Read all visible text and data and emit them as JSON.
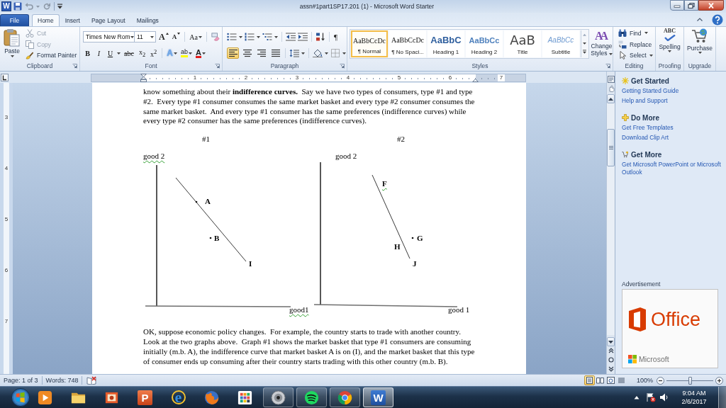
{
  "title_bar": {
    "app_glyph": "W",
    "title": "assn#1part1SP17.201 (1) - Microsoft Word Starter"
  },
  "tabs": [
    {
      "label": "File",
      "kind": "file",
      "selected": false
    },
    {
      "label": "Home",
      "kind": "tab",
      "selected": true
    },
    {
      "label": "Insert",
      "kind": "tab",
      "selected": false
    },
    {
      "label": "Page Layout",
      "kind": "tab",
      "selected": false
    },
    {
      "label": "Mailings",
      "kind": "tab",
      "selected": false
    }
  ],
  "clipboard": {
    "paste": "Paste",
    "actions": [
      {
        "label": "Cut",
        "kind": "cut",
        "disabled": true
      },
      {
        "label": "Copy",
        "kind": "copy",
        "disabled": true
      },
      {
        "label": "Format Painter",
        "kind": "painter",
        "disabled": false
      }
    ],
    "label": "Clipboard"
  },
  "font": {
    "name": "Times New Rom",
    "size": "11",
    "grow": "A",
    "shrink": "A",
    "change_case": "Aa",
    "formats": [
      {
        "label": "B",
        "kind": "bold"
      },
      {
        "label": "I",
        "kind": "italic"
      },
      {
        "label": "U",
        "kind": "underline"
      },
      {
        "label": "abc",
        "kind": "strike"
      },
      {
        "label": "x$_{2}$",
        "kind": "subscript"
      },
      {
        "label": "x$^{2}$",
        "kind": "superscript"
      }
    ],
    "effects": "A",
    "highlight": "ab",
    "color_button": "A",
    "label": "Font"
  },
  "paragraph": {
    "show_marks": "¶",
    "alignments": [
      {
        "kind": "left",
        "selected": true
      },
      {
        "kind": "center",
        "selected": false
      },
      {
        "kind": "right",
        "selected": false
      },
      {
        "kind": "justify",
        "selected": false
      }
    ],
    "label": "Paragraph"
  },
  "styles": {
    "gallery": [
      {
        "sample": "AaBbCcDc",
        "name": "¶ Normal",
        "kind": "normal",
        "selected": true
      },
      {
        "sample": "AaBbCcDc",
        "name": "¶ No Spaci...",
        "kind": "normal",
        "selected": false
      },
      {
        "sample": "AaBbC",
        "name": "Heading 1",
        "kind": "heading1",
        "selected": false
      },
      {
        "sample": "AaBbCc",
        "name": "Heading 2",
        "kind": "heading2",
        "selected": false
      },
      {
        "sample": "AaB",
        "name": "Title",
        "kind": "title",
        "selected": false
      },
      {
        "sample": "AaBbCc",
        "name": "Subtitle",
        "kind": "subtitle",
        "selected": false
      }
    ],
    "change_glyph": "AA",
    "change": "Change Styles",
    "label": "Styles"
  },
  "editing": {
    "actions": [
      {
        "label": "Find",
        "kind": "find",
        "menu": true
      },
      {
        "label": "Replace",
        "kind": "replace",
        "menu": false
      },
      {
        "label": "Select",
        "kind": "select",
        "menu": true
      }
    ],
    "label": "Editing"
  },
  "proofing": {
    "glyph": "ABC",
    "button": "Spelling",
    "label": "Proofing"
  },
  "upgrade": {
    "button": "Purchase",
    "label": "Upgrade"
  },
  "rulers": {
    "horizontal": [
      "1",
      "2",
      "3",
      "4",
      "5",
      "6",
      "7"
    ],
    "vertical": [
      "3",
      "4",
      "5",
      "6",
      "7"
    ]
  },
  "document": {
    "intro": "know something about their **indifference curves.**  Say we have two types of consumers, type #1 and type #2.  Every type #1 consumer consumes the same market basket and every type #2 consumer consumes the same market basket.  And every type #1 consumer has the same preferences (indifference curves) while every type #2 consumer has the same preferences (indifference curves).",
    "graphs": [
      {
        "heading": "#1",
        "y_label": {
          "text": "good 2",
          "flagged": true
        },
        "x_label": {
          "text": "good1",
          "flagged": true
        },
        "labels": [
          {
            "text": "A",
            "dot": true,
            "flagged": false
          },
          {
            "text": "B",
            "dot": true,
            "flagged": false
          },
          {
            "text": "I",
            "dot": false,
            "flagged": false
          }
        ]
      },
      {
        "heading": "#2",
        "y_label": {
          "text": "good 2",
          "flagged": false
        },
        "x_label": {
          "text": "good 1",
          "flagged": false
        },
        "labels": [
          {
            "text": "F",
            "dot": false,
            "flagged": true
          },
          {
            "text": "G",
            "dot": true,
            "flagged": false
          },
          {
            "text": "H",
            "dot": false,
            "flagged": false
          },
          {
            "text": "J",
            "dot": false,
            "flagged": false
          }
        ]
      }
    ],
    "body": "OK, suppose economic policy changes.  For example, the country starts to trade with another country.  Look at the two graphs above.  Graph #1 shows the market basket that type #1 consumers are consuming initially (m.b. A), the indifference curve that market basket A is on (I), and the market basket that this type of consumer ends up consuming after their country starts trading with this other country (m.b. B)."
  },
  "task_pane": {
    "sections": [
      {
        "kind": "sparkle",
        "title": "Get Started",
        "links": [
          "Getting Started Guide",
          "Help and Support"
        ]
      },
      {
        "kind": "plus",
        "title": "Do More",
        "links": [
          "Get Free Templates",
          "Download Clip Art"
        ]
      },
      {
        "kind": "cart",
        "title": "Get More",
        "links": [
          "Get Microsoft PowerPoint or Microsoft Outlook"
        ]
      }
    ],
    "ad_label": "Advertisement",
    "ad": {
      "product": "Office",
      "brand": "Microsoft"
    }
  },
  "status_bar": {
    "page": "Page: 1 of 3",
    "words": "Words: 748",
    "views": [
      {
        "kind": "print",
        "selected": true
      },
      {
        "kind": "reading",
        "selected": false
      },
      {
        "kind": "web",
        "selected": false
      },
      {
        "kind": "draft",
        "selected": false
      }
    ],
    "zoom": "100%",
    "zoom_slider": {
      "level": 0.5
    }
  },
  "taskbar": {
    "apps": [
      {
        "kind": "media",
        "running": false,
        "selected": false
      },
      {
        "kind": "folder",
        "running": false,
        "selected": false
      },
      {
        "kind": "photos",
        "running": false,
        "selected": false
      },
      {
        "kind": "presentation",
        "glyph": "P",
        "running": false,
        "selected": false
      },
      {
        "kind": "browser",
        "glyph": "e",
        "running": false,
        "selected": false
      },
      {
        "kind": "fox",
        "running": false,
        "selected": false
      },
      {
        "kind": "grid",
        "running": false,
        "selected": false
      },
      {
        "kind": "disc",
        "running": true,
        "selected": false
      },
      {
        "kind": "waves",
        "running": true,
        "selected": false
      },
      {
        "kind": "wheel",
        "running": true,
        "selected": false
      },
      {
        "kind": "word",
        "glyph": "W",
        "running": true,
        "selected": true
      }
    ],
    "time": "9:04 AM",
    "date": "2/6/2017"
  }
}
